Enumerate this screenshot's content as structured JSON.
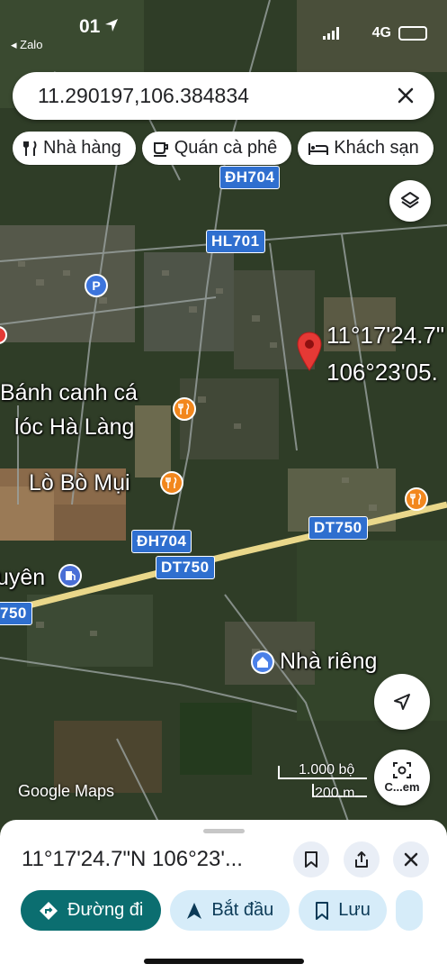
{
  "status_bar": {
    "time": "01",
    "back_app": "Zalo",
    "network": "4G"
  },
  "search": {
    "query": "11.290197,106.384834"
  },
  "chips": [
    {
      "label": "Nhà hàng",
      "icon": "restaurant-icon"
    },
    {
      "label": "Quán cà phê",
      "icon": "coffee-icon"
    },
    {
      "label": "Khách sạn",
      "icon": "hotel-icon"
    }
  ],
  "map": {
    "roads": [
      "ĐH704",
      "HL701",
      "DT750",
      "ĐH704",
      "DT750",
      "750"
    ],
    "places": {
      "banh_canh_line1": "Bánh canh cá",
      "banh_canh_line2": "lóc Hà Làng",
      "lo_bo": "Lò Bò Mụi",
      "partial_left": "uyên",
      "nha_rieng": "Nhà riêng"
    },
    "pin_label": {
      "line1": "11°17'24.7\"",
      "line2": "106°23'05."
    },
    "scale": {
      "upper": "1.000 bộ",
      "lower": "200 m"
    },
    "attribution": "Google Maps",
    "camera_label": "C...em"
  },
  "sheet": {
    "title": "11°17'24.7\"N 106°23'...",
    "actions": [
      {
        "label": "Đường đi",
        "icon": "directions-icon"
      },
      {
        "label": "Bắt đầu",
        "icon": "navigation-arrow-icon"
      },
      {
        "label": "Lưu",
        "icon": "bookmark-icon"
      }
    ]
  },
  "colors": {
    "accent": "#0b6e70",
    "road_label": "#2f6fcf",
    "pin": "#e53935",
    "poi_food": "#f2871d"
  }
}
